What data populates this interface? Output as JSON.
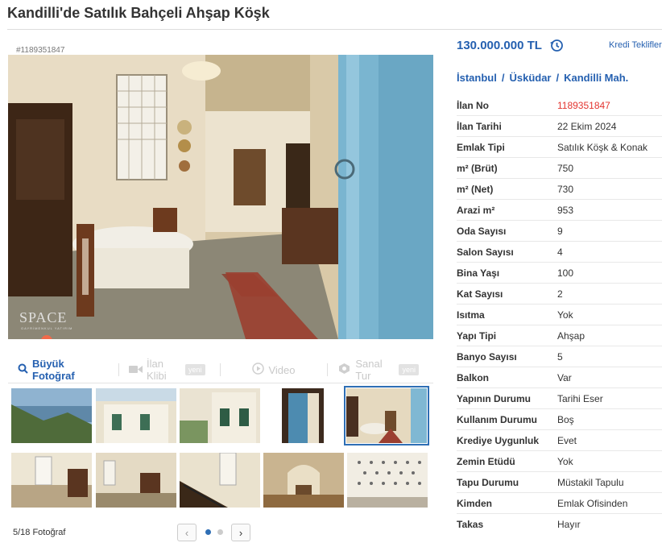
{
  "title": "Kandilli'de Satılık Bahçeli Ahşap Köşk",
  "listing_id_tag": "#1189351847",
  "photo": {
    "logo": "SPACE",
    "logo_sub": "GAYRİMENKUL YATIRIM"
  },
  "media_tabs": {
    "big_photo": "Büyük Fotoğraf",
    "video_clip": "İlan Klibi",
    "video": "Video",
    "virtual_tour": "Sanal Tur",
    "new_badge": "yeni"
  },
  "thumbnails": [
    "thumb-1",
    "thumb-2",
    "thumb-3",
    "thumb-4",
    "thumb-5",
    "thumb-6",
    "thumb-7",
    "thumb-8",
    "thumb-9",
    "thumb-10"
  ],
  "selected_thumb": 5,
  "photo_count": "5/18 Fotoğraf",
  "price": "130.000.000 TL",
  "credit_link": "Kredi Teklifleri",
  "breadcrumb": [
    "İstanbul",
    "Üsküdar",
    "Kandilli Mah."
  ],
  "info": [
    {
      "label": "İlan No",
      "value": "1189351847"
    },
    {
      "label": "İlan Tarihi",
      "value": "22 Ekim 2024"
    },
    {
      "label": "Emlak Tipi",
      "value": "Satılık Köşk & Konak"
    },
    {
      "label": "m² (Brüt)",
      "value": "750"
    },
    {
      "label": "m² (Net)",
      "value": "730"
    },
    {
      "label": "Arazi m²",
      "value": "953"
    },
    {
      "label": "Oda Sayısı",
      "value": "9"
    },
    {
      "label": "Salon Sayısı",
      "value": "4"
    },
    {
      "label": "Bina Yaşı",
      "value": "100"
    },
    {
      "label": "Kat Sayısı",
      "value": "2"
    },
    {
      "label": "Isıtma",
      "value": "Yok"
    },
    {
      "label": "Yapı Tipi",
      "value": "Ahşap"
    },
    {
      "label": "Banyo Sayısı",
      "value": "5"
    },
    {
      "label": "Balkon",
      "value": "Var"
    },
    {
      "label": "Yapının Durumu",
      "value": "Tarihi Eser"
    },
    {
      "label": "Kullanım Durumu",
      "value": "Boş"
    },
    {
      "label": "Krediye Uygunluk",
      "value": "Evet"
    },
    {
      "label": "Zemin Etüdü",
      "value": "Yok"
    },
    {
      "label": "Tapu Durumu",
      "value": "Müstakil Tapulu"
    },
    {
      "label": "Kimden",
      "value": "Emlak Ofisinden"
    },
    {
      "label": "Takas",
      "value": "Hayır"
    }
  ],
  "colors": {
    "accent": "#2560b0",
    "id_red": "#e3342f"
  }
}
